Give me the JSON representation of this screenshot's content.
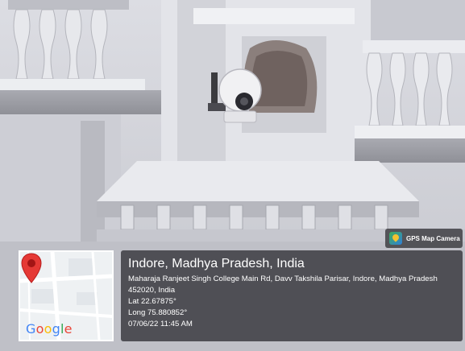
{
  "badge": {
    "label": "GPS Map Camera",
    "icon": "gps-map-camera-app-icon"
  },
  "location": {
    "title": "Indore, Madhya Pradesh, India",
    "address": "Maharaja Ranjeet Singh College Main Rd, Davv Takshila Parisar, Indore, Madhya Pradesh 452020, India",
    "lat": "Lat 22.67875°",
    "long": "Long 75.880852°",
    "timestamp": "07/06/22 11:45 AM"
  },
  "map": {
    "logo": "Google",
    "pin_icon": "map-pin-icon",
    "colors": {
      "pin": "#e53935",
      "roads": "#ffffff",
      "overlay": "#303034"
    }
  }
}
